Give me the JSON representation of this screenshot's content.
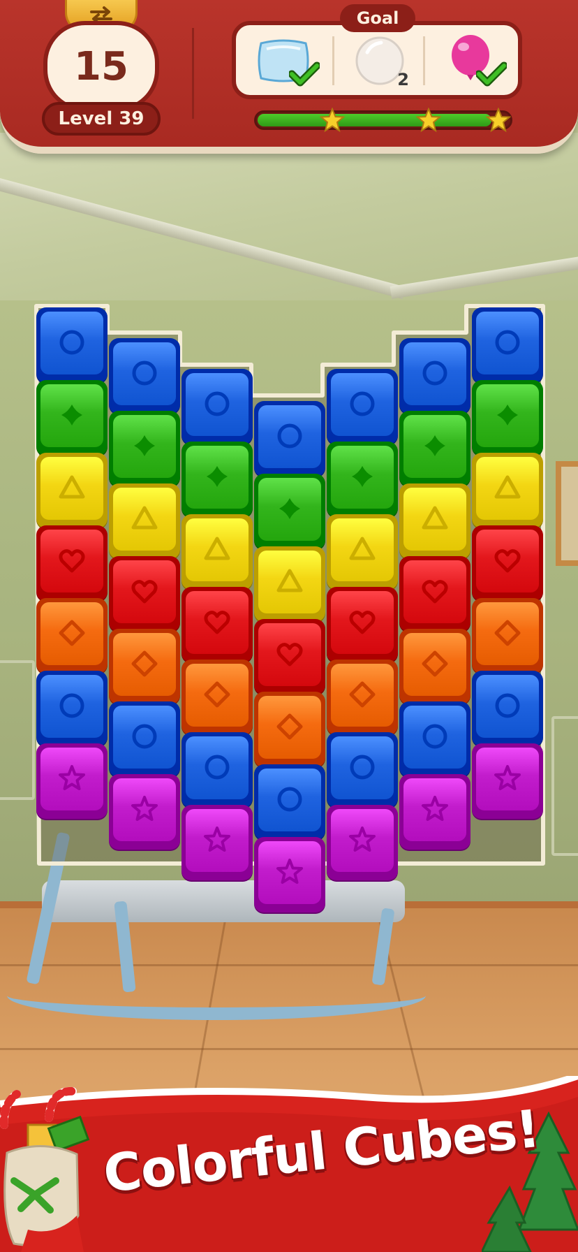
{
  "hud": {
    "moves_left": "15",
    "level_label": "Level 39",
    "goal_label": "Goal",
    "goals": [
      {
        "item": "pillow",
        "icon": "pillow-icon",
        "status": "complete",
        "count": ""
      },
      {
        "item": "bubble",
        "icon": "bubble-icon",
        "status": "remaining",
        "count": "2"
      },
      {
        "item": "balloon",
        "icon": "pink-balloon-icon",
        "status": "complete",
        "count": ""
      }
    ],
    "progress_fraction": 0.93,
    "stars": 3
  },
  "board": {
    "colors": {
      "blue": "#1f63e0",
      "green": "#33b51c",
      "yellow": "#f3d613",
      "red": "#e3171c",
      "orange": "#f56b10",
      "purple": "#c21ccc"
    },
    "columns": [
      [
        "blue",
        "green",
        "yellow",
        "red",
        "orange",
        "blue",
        "purple"
      ],
      [
        "blue",
        "green",
        "yellow",
        "red",
        "orange",
        "blue",
        "purple"
      ],
      [
        "blue",
        "green",
        "yellow",
        "red",
        "orange",
        "blue",
        "purple"
      ],
      [
        "blue",
        "green",
        "yellow",
        "red",
        "orange",
        "blue",
        "purple"
      ],
      [
        "blue",
        "green",
        "yellow",
        "red",
        "orange",
        "blue",
        "purple"
      ],
      [
        "blue",
        "green",
        "yellow",
        "red",
        "orange",
        "blue",
        "purple"
      ],
      [
        "blue",
        "green",
        "yellow",
        "red",
        "orange",
        "blue",
        "purple"
      ]
    ]
  },
  "banner": {
    "title": "Colorful Cubes!"
  }
}
